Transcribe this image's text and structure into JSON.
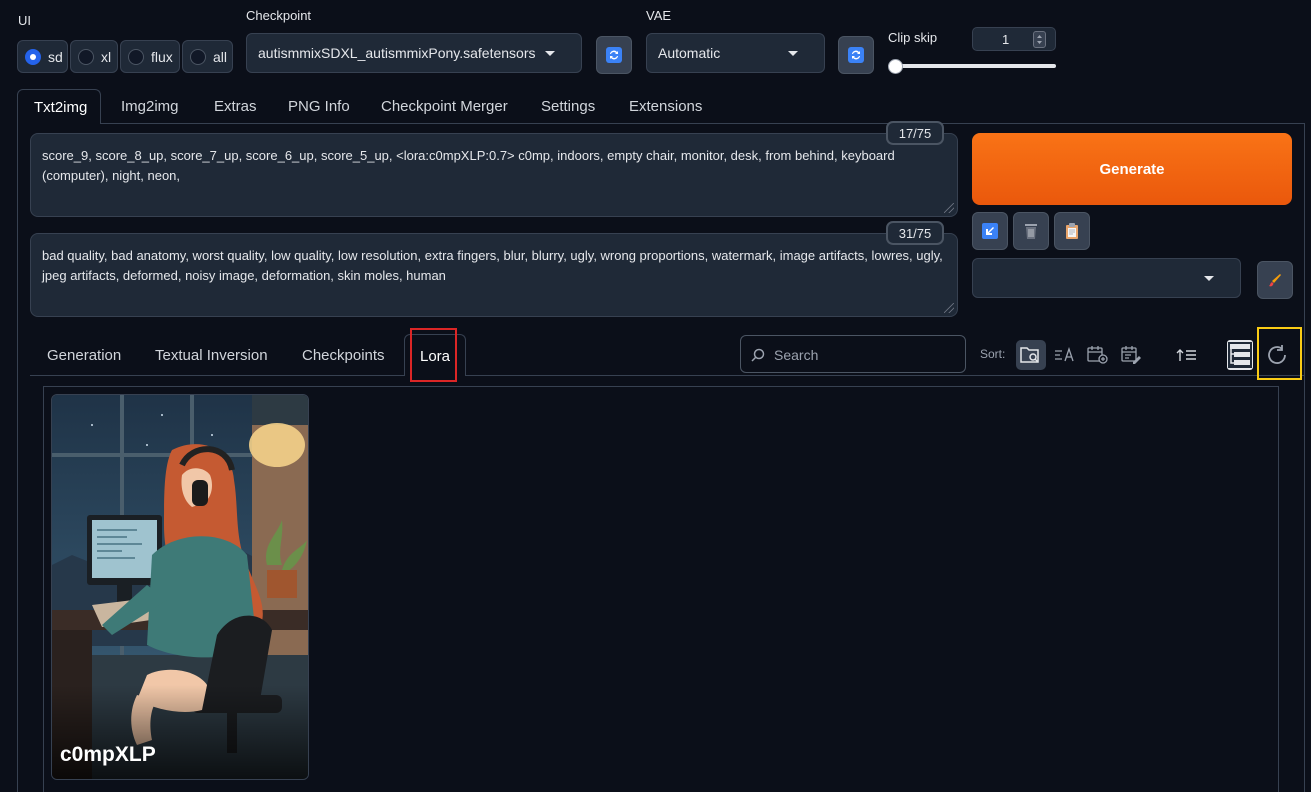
{
  "top": {
    "ui_label": "UI",
    "ui_options": [
      "sd",
      "xl",
      "flux",
      "all"
    ],
    "ui_selected": "sd",
    "checkpoint_label": "Checkpoint",
    "checkpoint_value": "autismmixSDXL_autismmixPony.safetensors",
    "vae_label": "VAE",
    "vae_value": "Automatic",
    "clip_skip_label": "Clip skip",
    "clip_skip_value": "1",
    "clip_skip_slider_fraction": 0.0
  },
  "main_tabs": [
    "Txt2img",
    "Img2img",
    "Extras",
    "PNG Info",
    "Checkpoint Merger",
    "Settings",
    "Extensions"
  ],
  "main_tab_active": "Txt2img",
  "prompt": {
    "positive_text": "score_9, score_8_up, score_7_up, score_6_up, score_5_up, <lora:c0mpXLP:0.7> c0mp, indoors, empty chair, monitor, desk, from behind, keyboard (computer), night, neon,",
    "positive_counter": "17/75",
    "negative_text": "bad quality, bad anatomy, worst quality, low quality, low resolution, extra fingers, blur, blurry, ugly, wrong proportions, watermark, image artifacts, lowres, ugly,  jpeg artifacts, deformed, noisy image, deformation, skin moles, human",
    "negative_counter": "31/75"
  },
  "generate": {
    "label": "Generate",
    "color": "#f97316"
  },
  "network_tabs": [
    "Generation",
    "Textual Inversion",
    "Checkpoints",
    "Lora"
  ],
  "network_tab_active": "Lora",
  "search": {
    "placeholder": "Search"
  },
  "sort_label": "Sort:",
  "cards": [
    {
      "name": "c0mpXLP"
    }
  ],
  "highlight_colors": {
    "red": "#dc2626",
    "yellow": "#facc15"
  }
}
